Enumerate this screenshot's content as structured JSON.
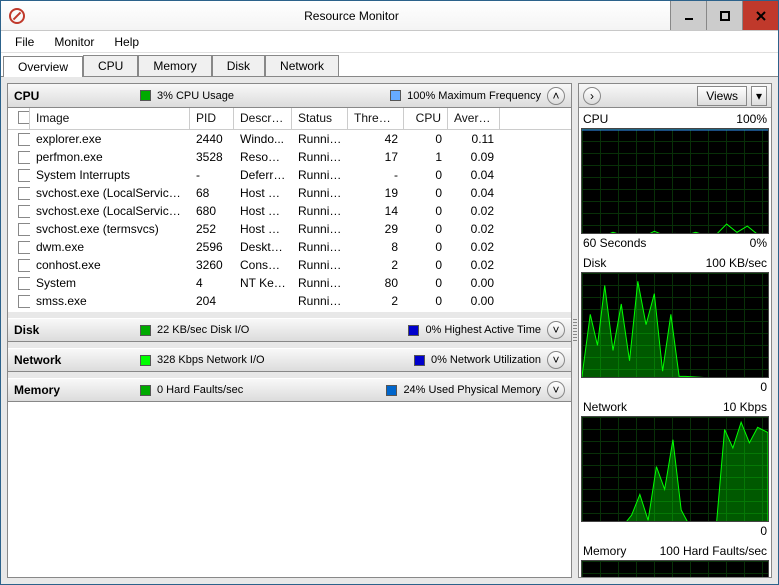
{
  "window": {
    "title": "Resource Monitor"
  },
  "menubar": {
    "file": "File",
    "monitor": "Monitor",
    "help": "Help"
  },
  "tabs": {
    "overview": "Overview",
    "cpu": "CPU",
    "memory": "Memory",
    "disk": "Disk",
    "network": "Network"
  },
  "cpu_header": {
    "title": "CPU",
    "usage_label": "3% CPU Usage",
    "freq_label": "100% Maximum Frequency"
  },
  "columns": {
    "image": "Image",
    "pid": "PID",
    "desc": "Descrip...",
    "status": "Status",
    "threads": "Threads",
    "cpu": "CPU",
    "avg": "Averag..."
  },
  "processes": [
    {
      "image": "explorer.exe",
      "pid": "2440",
      "desc": "Windo...",
      "status": "Running",
      "threads": "42",
      "cpu": "0",
      "avg": "0.11"
    },
    {
      "image": "perfmon.exe",
      "pid": "3528",
      "desc": "Resour...",
      "status": "Running",
      "threads": "17",
      "cpu": "1",
      "avg": "0.09"
    },
    {
      "image": "System Interrupts",
      "pid": "-",
      "desc": "Deferre...",
      "status": "Running",
      "threads": "-",
      "cpu": "0",
      "avg": "0.04"
    },
    {
      "image": "svchost.exe (LocalServiceNo...",
      "pid": "68",
      "desc": "Host Pr...",
      "status": "Running",
      "threads": "19",
      "cpu": "0",
      "avg": "0.04"
    },
    {
      "image": "svchost.exe (LocalServiceNet...",
      "pid": "680",
      "desc": "Host Pr...",
      "status": "Running",
      "threads": "14",
      "cpu": "0",
      "avg": "0.02"
    },
    {
      "image": "svchost.exe (termsvcs)",
      "pid": "252",
      "desc": "Host Pr...",
      "status": "Running",
      "threads": "29",
      "cpu": "0",
      "avg": "0.02"
    },
    {
      "image": "dwm.exe",
      "pid": "2596",
      "desc": "Deskto...",
      "status": "Running",
      "threads": "8",
      "cpu": "0",
      "avg": "0.02"
    },
    {
      "image": "conhost.exe",
      "pid": "3260",
      "desc": "Consol...",
      "status": "Running",
      "threads": "2",
      "cpu": "0",
      "avg": "0.02"
    },
    {
      "image": "System",
      "pid": "4",
      "desc": "NT Ker...",
      "status": "Running",
      "threads": "80",
      "cpu": "0",
      "avg": "0.00"
    },
    {
      "image": "smss.exe",
      "pid": "204",
      "desc": "",
      "status": "Running",
      "threads": "2",
      "cpu": "0",
      "avg": "0.00"
    }
  ],
  "disk_header": {
    "title": "Disk",
    "io_label": "22 KB/sec Disk I/O",
    "active_label": "0% Highest Active Time"
  },
  "net_header": {
    "title": "Network",
    "io_label": "328 Kbps Network I/O",
    "util_label": "0% Network Utilization"
  },
  "mem_header": {
    "title": "Memory",
    "faults_label": "0 Hard Faults/sec",
    "used_label": "24% Used Physical Memory"
  },
  "right_header": {
    "views": "Views"
  },
  "graphs": {
    "cpu": {
      "title": "CPU",
      "max": "100%",
      "bottom_left": "60 Seconds",
      "bottom_right": "0%"
    },
    "disk": {
      "title": "Disk",
      "max": "100 KB/sec",
      "bottom_right": "0"
    },
    "network": {
      "title": "Network",
      "max": "10 Kbps",
      "bottom_right": "0"
    },
    "memory": {
      "title": "Memory",
      "max": "100 Hard Faults/sec"
    }
  },
  "chart_data": [
    {
      "type": "line",
      "title": "CPU",
      "series_name": "CPU Usage %",
      "x_range": [
        0,
        60
      ],
      "ylim": [
        0,
        100
      ],
      "max_freq_line": 100,
      "approx_values": [
        2,
        3,
        2,
        5,
        3,
        2,
        1,
        6,
        3,
        4,
        2,
        3,
        5,
        2,
        3,
        12,
        5,
        3
      ]
    },
    {
      "type": "area",
      "title": "Disk",
      "series_name": "Disk I/O KB/sec",
      "x_range": [
        0,
        60
      ],
      "ylim": [
        0,
        100
      ],
      "approx_values": [
        5,
        60,
        40,
        90,
        30,
        70,
        20,
        95,
        50,
        80,
        10,
        60,
        5,
        5,
        0,
        0
      ]
    },
    {
      "type": "area",
      "title": "Network",
      "series_name": "Network I/O Kbps",
      "x_range": [
        0,
        60
      ],
      "ylim": [
        0,
        10
      ],
      "approx_values": [
        0,
        0,
        1,
        3,
        0,
        6,
        4,
        8,
        2,
        0,
        0,
        9,
        7,
        10,
        8,
        9
      ]
    },
    {
      "type": "line",
      "title": "Memory",
      "series_name": "Hard Faults/sec",
      "x_range": [
        0,
        60
      ],
      "ylim": [
        0,
        100
      ],
      "approx_values": []
    }
  ]
}
